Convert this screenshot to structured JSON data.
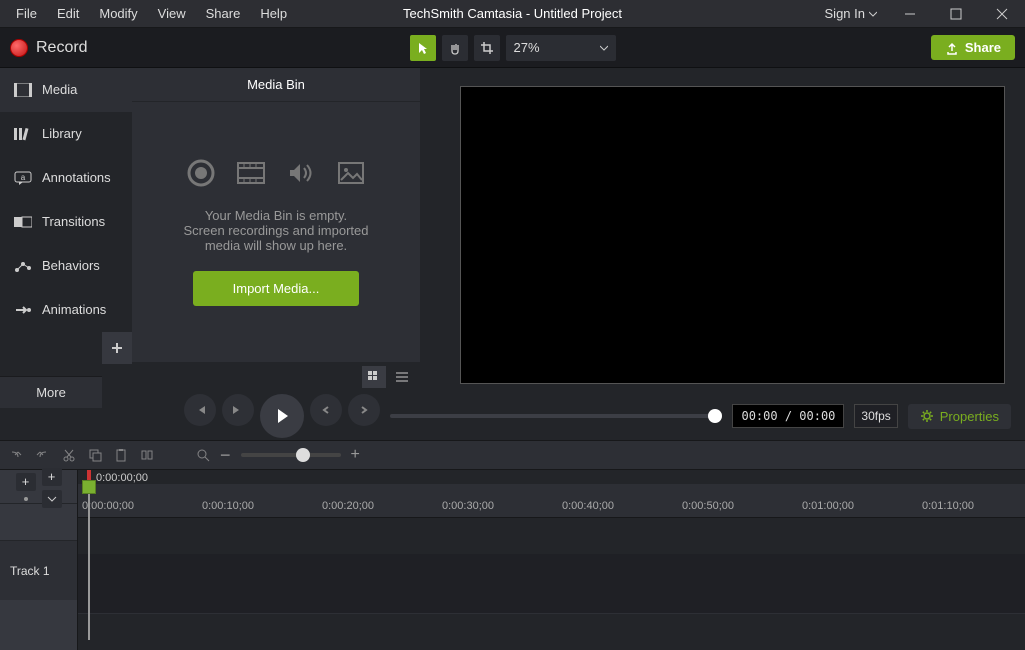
{
  "menu": [
    "File",
    "Edit",
    "Modify",
    "View",
    "Share",
    "Help"
  ],
  "title": "TechSmith Camtasia - Untitled Project",
  "signin": "Sign In",
  "record": "Record",
  "zoom": "27%",
  "share": "Share",
  "tabs": [
    "Media",
    "Library",
    "Annotations",
    "Transitions",
    "Behaviors",
    "Animations"
  ],
  "more": "More",
  "bin": {
    "title": "Media Bin",
    "empty1": "Your Media Bin is empty.",
    "empty2": "Screen recordings and imported",
    "empty3": "media will show up here.",
    "import": "Import Media..."
  },
  "time": "00:00 / 00:00",
  "fps": "30fps",
  "properties": "Properties",
  "cursor_time": "0:00:00;00",
  "ruler": [
    "0:00:00;00",
    "0:00:10;00",
    "0:00:20;00",
    "0:00:30;00",
    "0:00:40;00",
    "0:00:50;00",
    "0:01:00;00",
    "0:01:10;00"
  ],
  "track1": "Track 1"
}
